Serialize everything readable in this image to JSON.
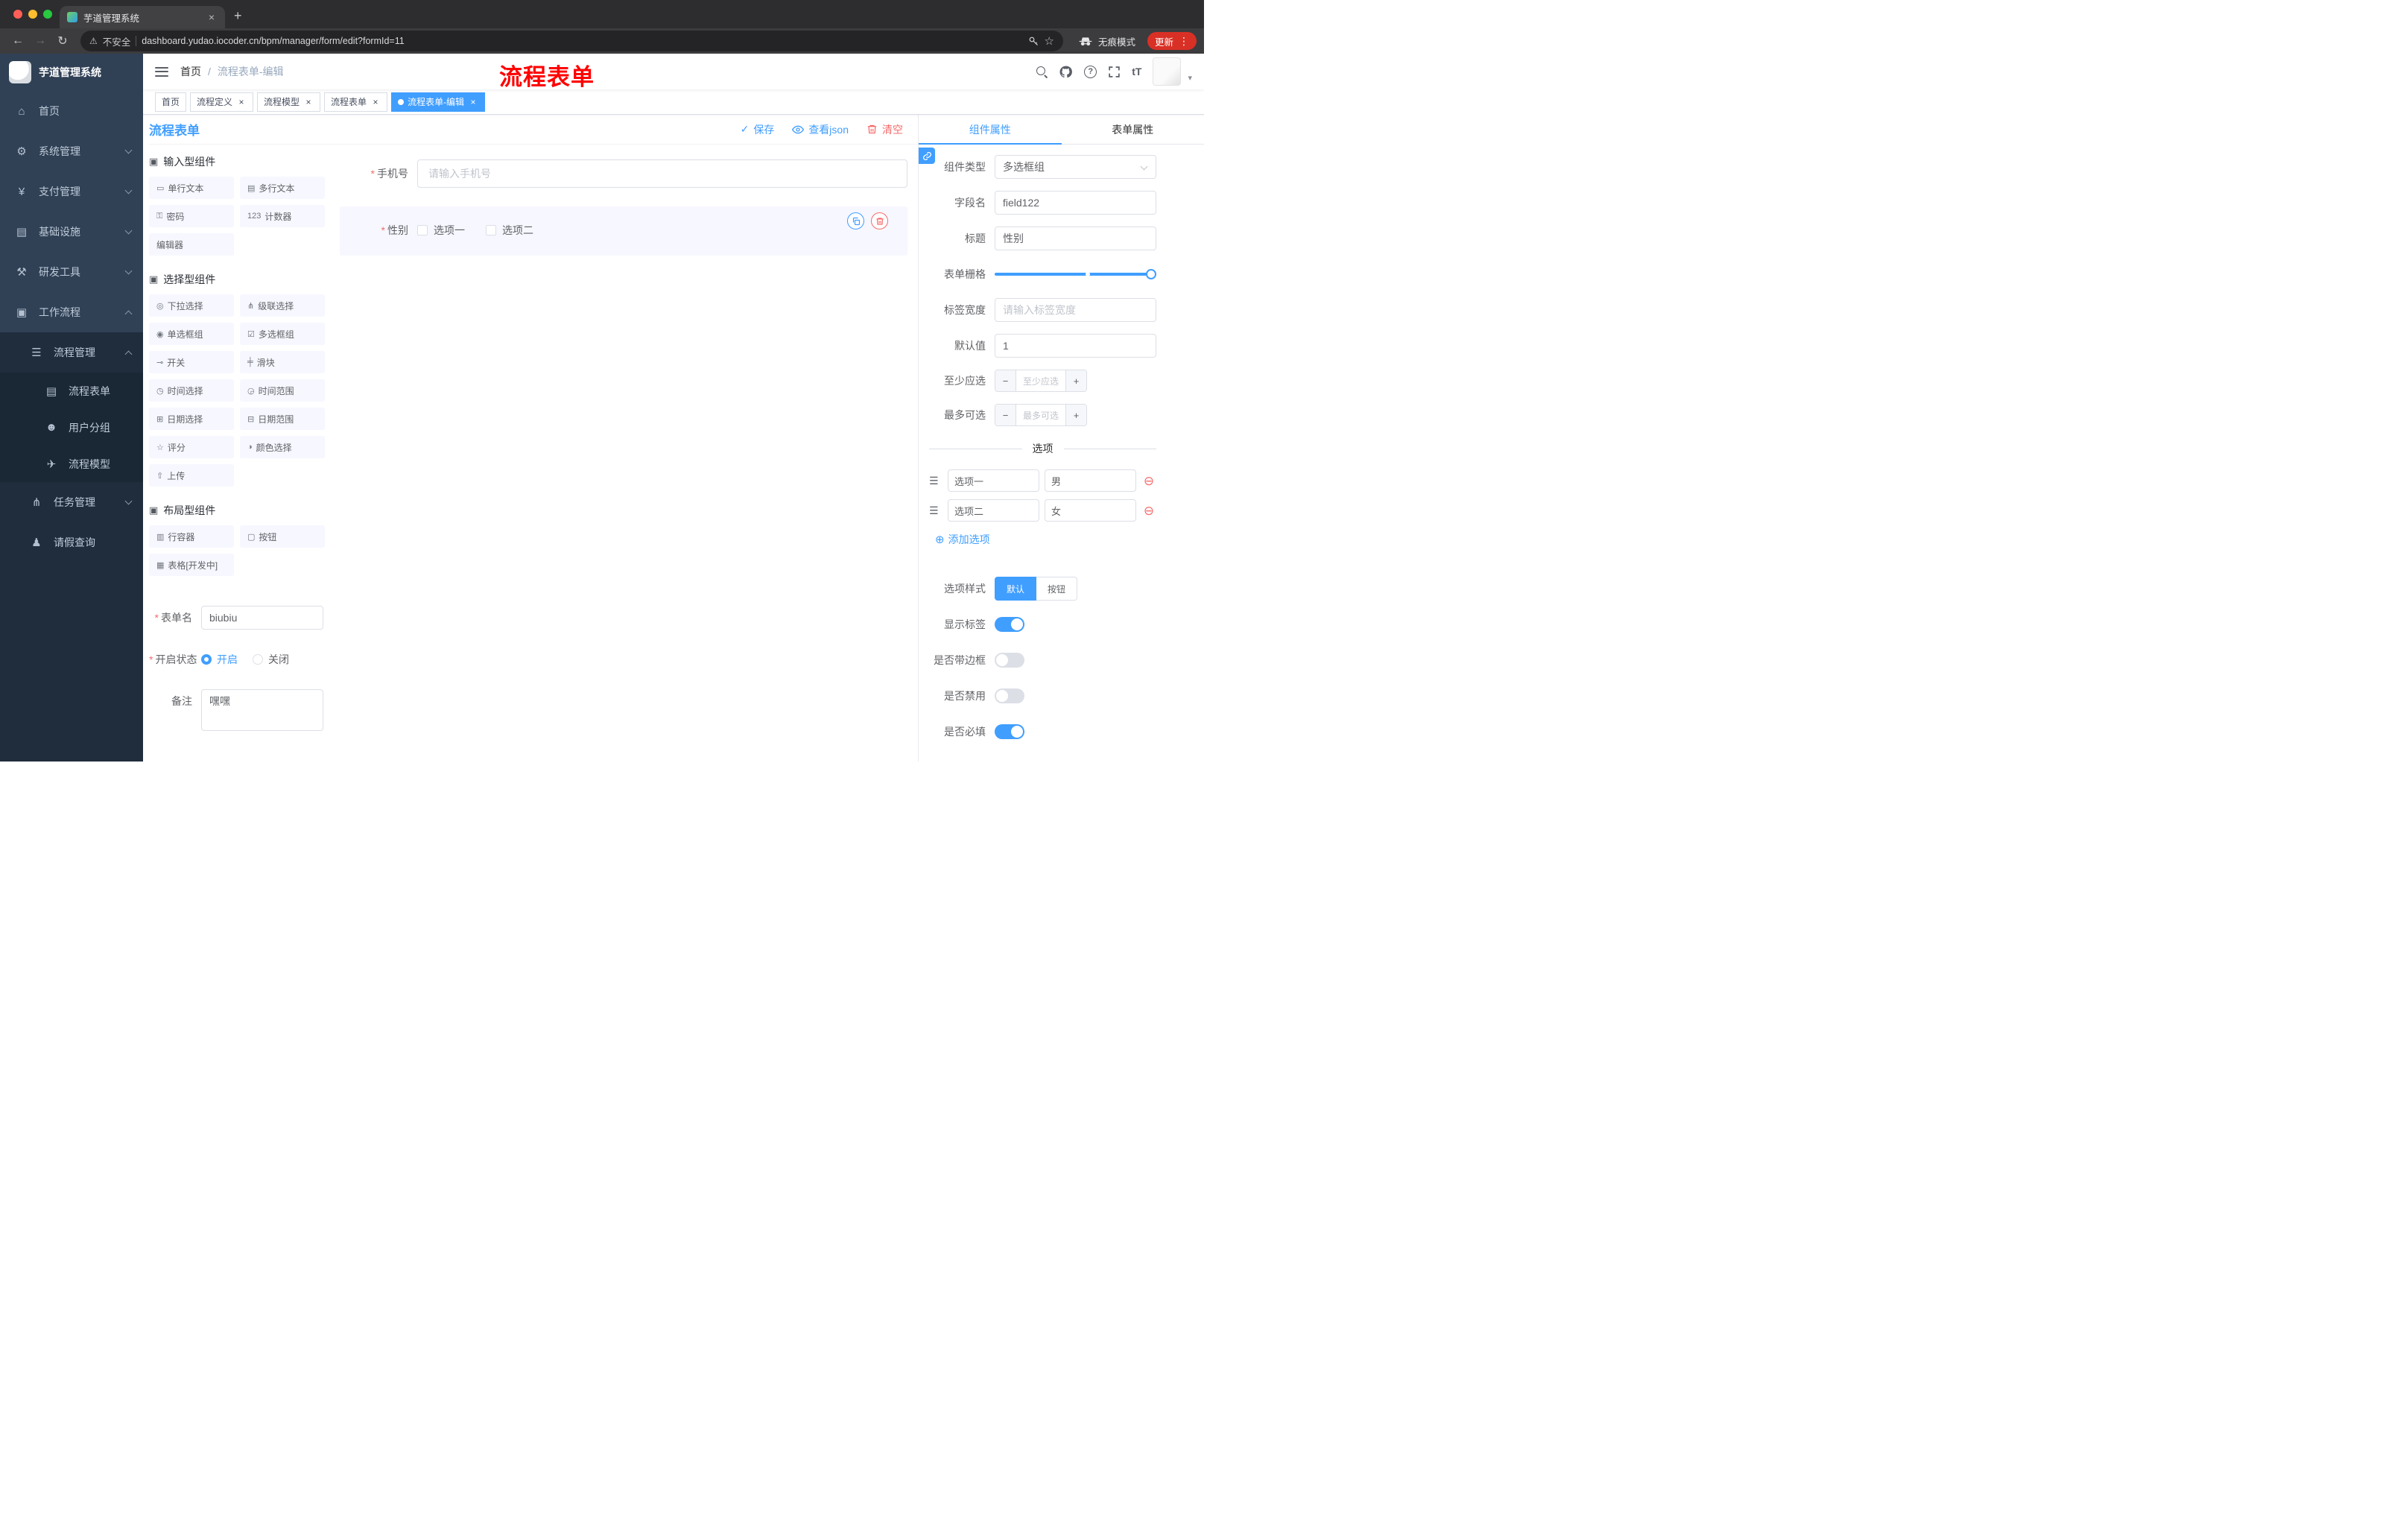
{
  "icons": {
    "back": "←",
    "forward": "→",
    "reload": "↻",
    "close": "×",
    "new_tab": "+",
    "warning": "⚠",
    "star": "☆",
    "more": "⋮",
    "slash": "/",
    "check": "✓",
    "question": "?",
    "font_size": "tT",
    "caret": "▾",
    "minus": "−",
    "plus": "+",
    "drag": "☰",
    "remove": "⊖",
    "add": "⊕",
    "asterisk": "*"
  },
  "browser": {
    "tab_title": "芋道管理系统",
    "security": "不安全",
    "url": "dashboard.yudao.iocoder.cn/bpm/manager/form/edit?formId=11",
    "incognito": "无痕模式",
    "update": "更新"
  },
  "sidebar": {
    "logo": "芋道管理系统",
    "menu": [
      {
        "label": "首页",
        "icon": "⌂",
        "expanded": false
      },
      {
        "label": "系统管理",
        "icon": "⚙",
        "expanded": false
      },
      {
        "label": "支付管理",
        "icon": "¥",
        "expanded": false
      },
      {
        "label": "基础设施",
        "icon": "▤",
        "expanded": false
      },
      {
        "label": "研发工具",
        "icon": "⚒",
        "expanded": false
      },
      {
        "label": "工作流程",
        "icon": "▣",
        "expanded": true
      }
    ],
    "process_mgmt": {
      "label": "流程管理",
      "icon": "☰",
      "expanded": true
    },
    "process_children": [
      {
        "label": "流程表单",
        "icon": "▤"
      },
      {
        "label": "用户分组",
        "icon": "☻"
      },
      {
        "label": "流程模型",
        "icon": "✈"
      }
    ],
    "task_mgmt": {
      "label": "任务管理",
      "icon": "⋔",
      "expanded": false
    },
    "leave_query": {
      "label": "请假查询",
      "icon": "♟"
    }
  },
  "navbar": {
    "breadcrumb_home": "首页",
    "breadcrumb_current": "流程表单-编辑",
    "overlay": "流程表单"
  },
  "tags": [
    {
      "label": "首页",
      "closable": false,
      "active": false
    },
    {
      "label": "流程定义",
      "closable": true,
      "active": false
    },
    {
      "label": "流程模型",
      "closable": true,
      "active": false
    },
    {
      "label": "流程表单",
      "closable": true,
      "active": false
    },
    {
      "label": "流程表单-编辑",
      "closable": true,
      "active": true
    }
  ],
  "editor": {
    "title": "流程表单",
    "actions": {
      "save": "保存",
      "view_json": "查看json",
      "clear": "清空"
    },
    "palette": {
      "groups": [
        {
          "icon": "▣",
          "title": "输入型组件",
          "items": [
            {
              "label": "单行文本",
              "icon": "▭"
            },
            {
              "label": "多行文本",
              "icon": "▤"
            },
            {
              "label": "密码",
              "icon": "⚿"
            },
            {
              "label": "计数器",
              "icon": "123"
            },
            {
              "label": "编辑器",
              "icon": ""
            }
          ]
        },
        {
          "icon": "▣",
          "title": "选择型组件",
          "items": [
            {
              "label": "下拉选择",
              "icon": "◎"
            },
            {
              "label": "级联选择",
              "icon": "⋔"
            },
            {
              "label": "单选框组",
              "icon": "◉"
            },
            {
              "label": "多选框组",
              "icon": "☑"
            },
            {
              "label": "开关",
              "icon": "⊸"
            },
            {
              "label": "滑块",
              "icon": "╪"
            },
            {
              "label": "时间选择",
              "icon": "◷"
            },
            {
              "label": "时间范围",
              "icon": "◶"
            },
            {
              "label": "日期选择",
              "icon": "⊞"
            },
            {
              "label": "日期范围",
              "icon": "⊟"
            },
            {
              "label": "评分",
              "icon": "☆"
            },
            {
              "label": "颜色选择",
              "icon": "◑"
            },
            {
              "label": "上传",
              "icon": "⇧"
            }
          ]
        },
        {
          "icon": "▣",
          "title": "布局型组件",
          "items": [
            {
              "label": "行容器",
              "icon": "▥"
            },
            {
              "label": "按钮",
              "icon": "▢"
            },
            {
              "label": "表格[开发中]",
              "icon": "▦"
            }
          ]
        }
      ]
    },
    "form_info": {
      "name_label": "表单名",
      "name_value": "biubiu",
      "status_label": "开启状态",
      "status_on": "开启",
      "status_off": "关闭",
      "remark_label": "备注",
      "remark_value": "嘿嘿"
    },
    "canvas": {
      "phone_label": "手机号",
      "phone_placeholder": "请输入手机号",
      "gender_label": "性别",
      "gender_opt1": "选项一",
      "gender_opt2": "选项二"
    },
    "panel": {
      "tab_component": "组件属性",
      "tab_form": "表单属性",
      "component_type_label": "组件类型",
      "component_type_value": "多选框组",
      "field_name_label": "字段名",
      "field_name_value": "field122",
      "title_label": "标题",
      "title_value": "性别",
      "grid_label": "表单栅格",
      "label_width_label": "标签宽度",
      "label_width_placeholder": "请输入标签宽度",
      "default_label": "默认值",
      "default_value": "1",
      "min_label": "至少应选",
      "min_placeholder": "至少应选",
      "max_label": "最多可选",
      "max_placeholder": "最多可选",
      "options_title": "选项",
      "options": [
        {
          "label": "选项一",
          "value": "男"
        },
        {
          "label": "选项二",
          "value": "女"
        }
      ],
      "add_option": "添加选项",
      "style_label": "选项样式",
      "style_default": "默认",
      "style_button": "按钮",
      "switch_show_label": "显示标签",
      "switch_border": "是否带边框",
      "switch_disabled": "是否禁用",
      "switch_required": "是否必填"
    }
  }
}
